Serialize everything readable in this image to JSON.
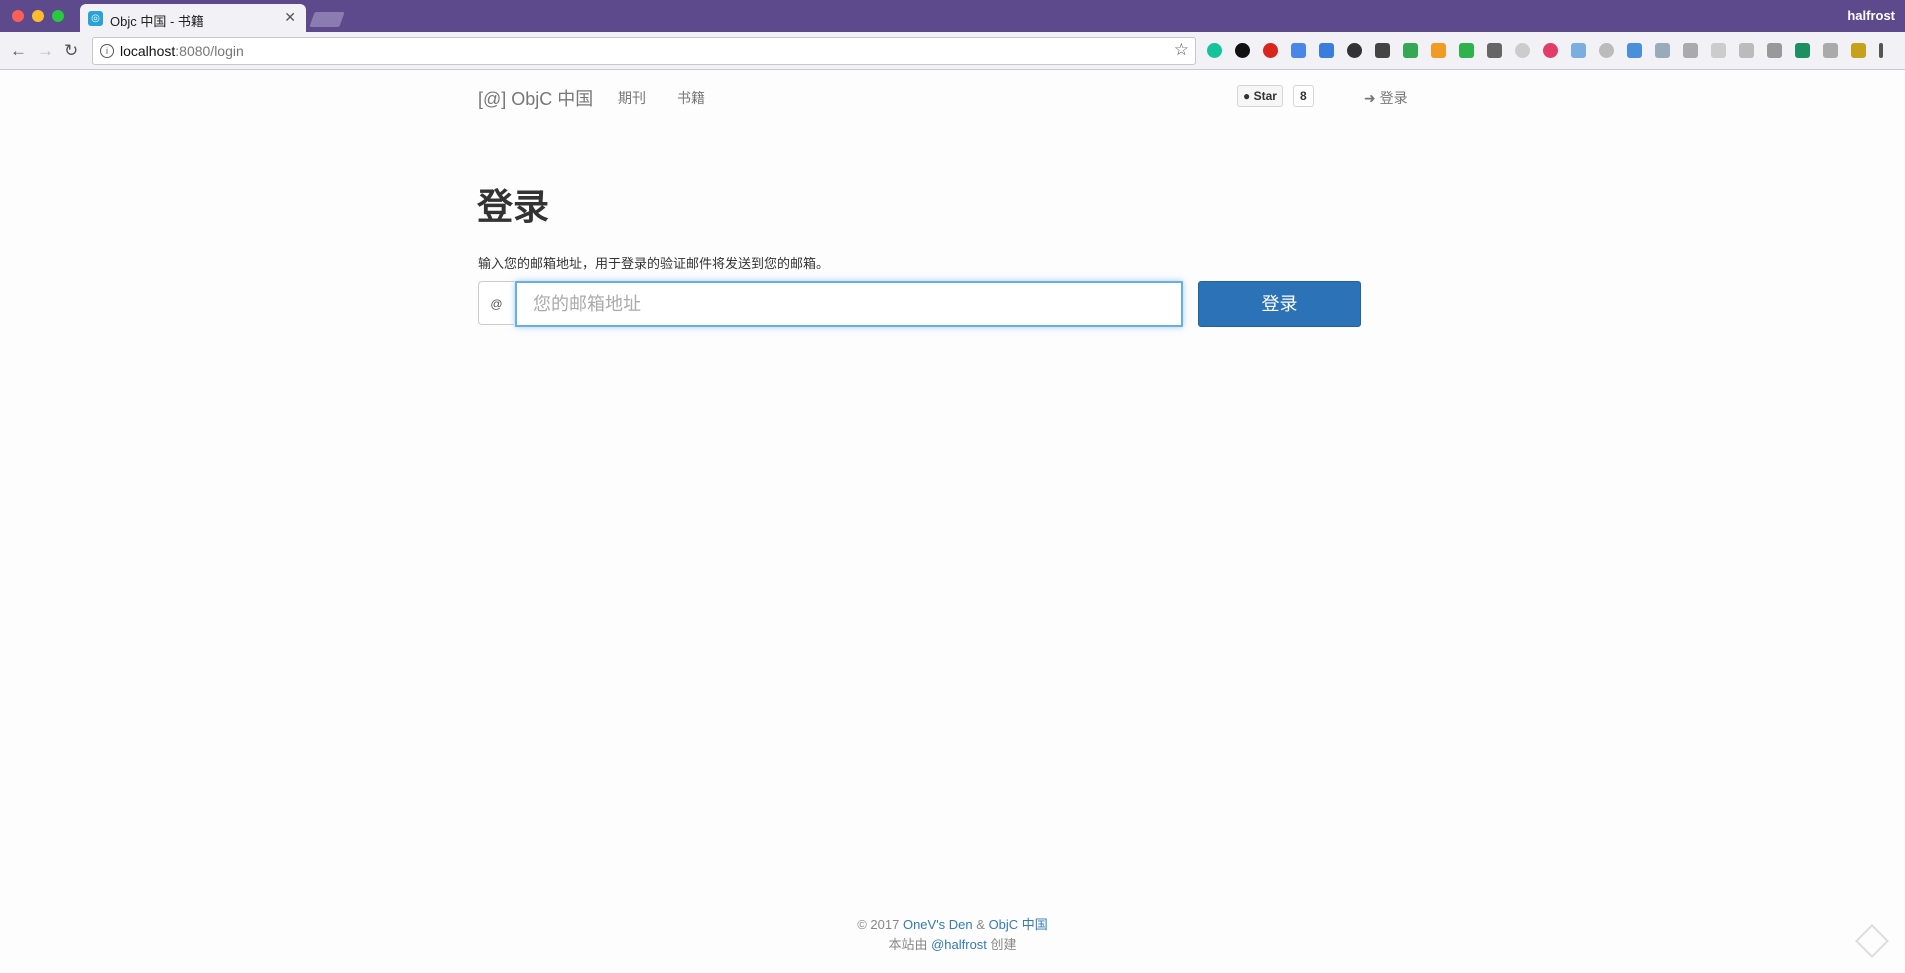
{
  "browser": {
    "tab_title": "Objc 中国 - 书籍",
    "tab_close": "✕",
    "profile_name": "halfrost",
    "url_host": "localhost",
    "url_path": ":8080/login",
    "info_glyph": "i",
    "star_glyph": "☆",
    "nav": {
      "back": "←",
      "forward": "→",
      "reload": "↻"
    }
  },
  "navbar": {
    "brand": "[@] ObjC 中国",
    "links": [
      "期刊",
      "书籍"
    ],
    "github_star_label": "Star",
    "github_star_count": "8",
    "login_label": "登录"
  },
  "login": {
    "heading": "登录",
    "description": "输入您的邮箱地址，用于登录的验证邮件将发送到您的邮箱。",
    "addon": "@",
    "email_placeholder": "您的邮箱地址",
    "submit_label": "登录"
  },
  "footer": {
    "copyright": "© 2017",
    "link1": "OneV's Den",
    "amp": "&",
    "link2": "ObjC 中国",
    "line2_prefix": "本站由",
    "author": "@halfrost",
    "line2_suffix": "创建"
  },
  "colors": {
    "titlebar": "#5c4a8c",
    "primary": "#2c72b6",
    "link": "#337ab7"
  },
  "extension_icons": [
    "grammarly-icon",
    "record-icon",
    "adblock-icon",
    "translate-icon",
    "calendar-icon",
    "power-icon",
    "pocket-icon",
    "drive-icon",
    "notes-icon",
    "shield-icon",
    "feedly-icon",
    "ext-icon",
    "toggl-icon",
    "bookmark-icon",
    "circle-icon",
    "screen-icon",
    "settings-icon",
    "rss-icon",
    "ext2-icon",
    "ext3-icon",
    "ext4-icon",
    "vue-icon",
    "ext5-icon",
    "image-icon",
    "menu-icon"
  ]
}
